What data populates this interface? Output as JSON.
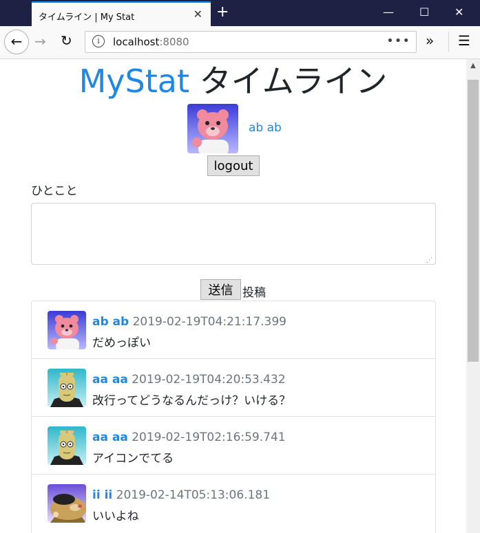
{
  "browser": {
    "tab_title": "タイムライン | My Stat",
    "tab_close": "✕",
    "new_tab": "+",
    "url_host": "localhost",
    "url_port": ":8080",
    "url_more": "•••",
    "window": {
      "minimize": "—",
      "maximize": "☐",
      "close": "✕"
    }
  },
  "page": {
    "brand": "MyStat",
    "title": "タイムライン",
    "profile": {
      "name": "ab ab",
      "avatar": "pink-bear-icon"
    },
    "logout_label": "logout",
    "memo_label": "ひとこと",
    "memo_value": "",
    "send_label": "送信",
    "send_suffix": "投稿"
  },
  "timeline": [
    {
      "user": "ab ab",
      "time": "2019-02-19T04:21:17.399",
      "text": "だめっぽい",
      "avatar": "pink-bear-icon"
    },
    {
      "user": "aa aa",
      "time": "2019-02-19T04:20:53.432",
      "text": "改行ってどうなるんだっけ？いける？",
      "avatar": "bald-man-icon"
    },
    {
      "user": "aa aa",
      "time": "2019-02-19T02:16:59.741",
      "text": "アイコンでてる",
      "avatar": "bald-man-icon"
    },
    {
      "user": "ii ii",
      "time": "2019-02-14T05:13:06.181",
      "text": "いいよね",
      "avatar": "mole-icon"
    }
  ]
}
